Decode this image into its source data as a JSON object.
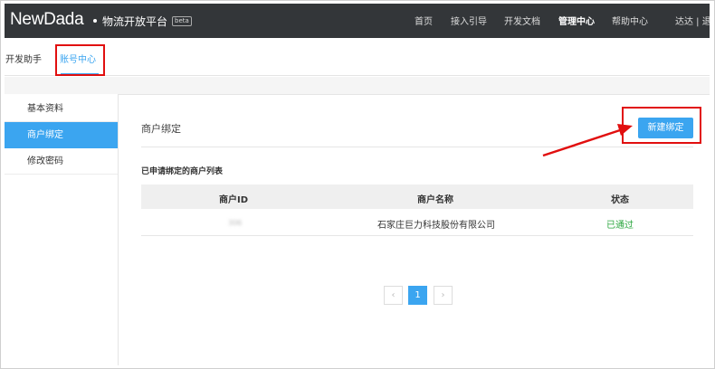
{
  "brand": {
    "logo": "NewDada",
    "platform_name": "物流开放平台",
    "beta_label": "beta"
  },
  "topnav": {
    "items": [
      {
        "label": "首页"
      },
      {
        "label": "接入引导"
      },
      {
        "label": "开发文档"
      },
      {
        "label": "管理中心"
      },
      {
        "label": "帮助中心"
      }
    ],
    "user": "达达 | 退"
  },
  "subnav": {
    "tabs": [
      {
        "label": "开发助手"
      },
      {
        "label": "账号中心"
      }
    ]
  },
  "sidebar": {
    "items": [
      {
        "label": "基本资料"
      },
      {
        "label": "商户绑定"
      },
      {
        "label": "修改密码"
      }
    ]
  },
  "main": {
    "section_title": "商户绑定",
    "new_binding_button": "新建绑定",
    "list_title": "已申请绑定的商户列表",
    "table": {
      "headers": [
        "商户ID",
        "商户名称",
        "状态"
      ],
      "rows": [
        {
          "merchant_id": "306",
          "merchant_name": "石家庄巨力科技股份有限公司",
          "status": "已通过"
        }
      ]
    },
    "pagination": {
      "prev": "‹",
      "current_page": "1",
      "next": "›"
    }
  },
  "colors": {
    "accent": "#3ba5f0",
    "topbar": "#333639",
    "annotation_red": "#e10f0f",
    "status_ok": "#2aa63e"
  }
}
